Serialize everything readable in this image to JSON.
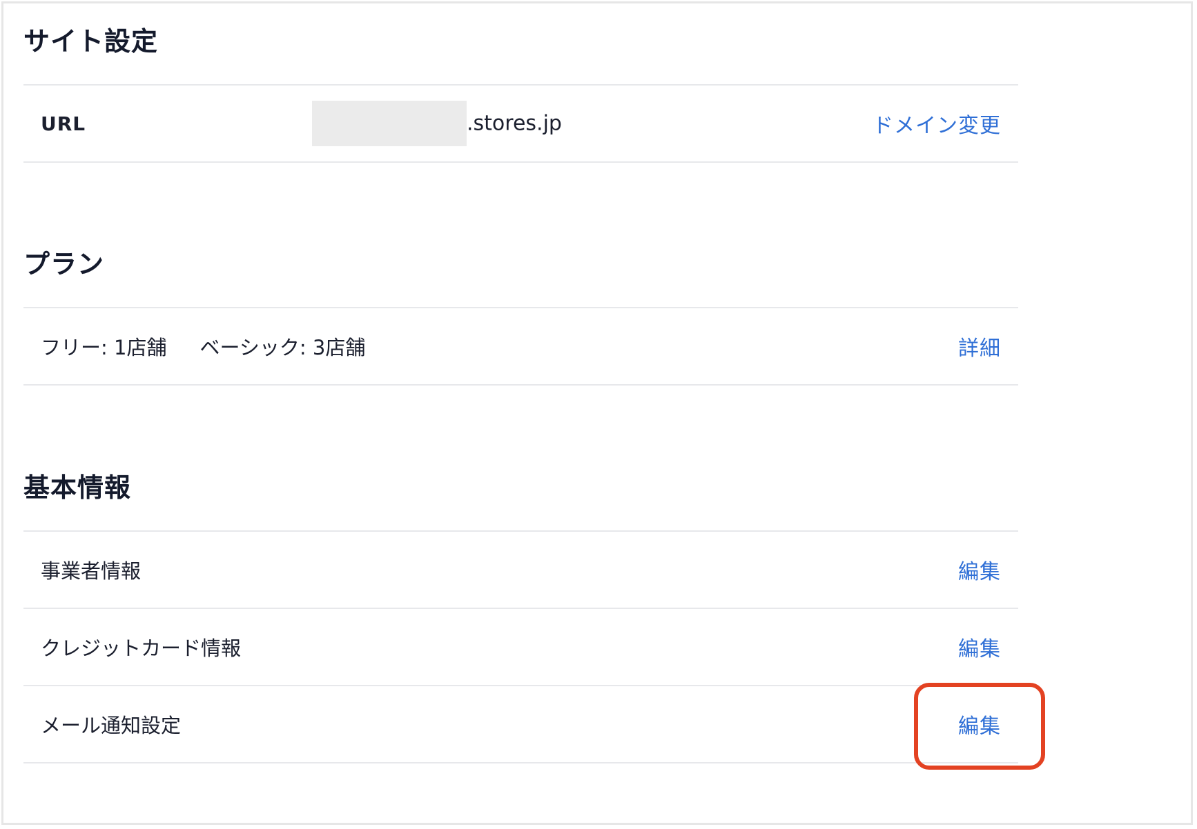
{
  "sections": {
    "site": {
      "title": "サイト設定",
      "url_label": "URL",
      "url_suffix": ".stores.jp",
      "action": "ドメイン変更"
    },
    "plan": {
      "title": "プラン",
      "free": "フリー: 1店舗",
      "basic": "ベーシック: 3店舗",
      "action": "詳細"
    },
    "basic": {
      "title": "基本情報",
      "rows": [
        {
          "label": "事業者情報",
          "action": "編集"
        },
        {
          "label": "クレジットカード情報",
          "action": "編集"
        },
        {
          "label": "メール通知設定",
          "action": "編集"
        }
      ]
    }
  },
  "colors": {
    "link": "#2f6fd6",
    "highlight": "#e34222",
    "title": "#141a2c",
    "divider": "#e7e8eb"
  }
}
